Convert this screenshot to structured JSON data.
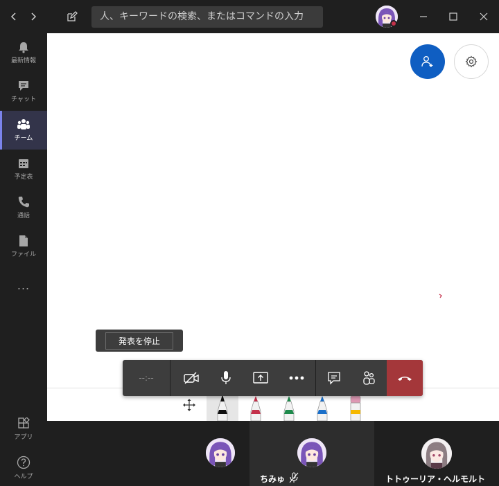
{
  "titlebar": {
    "search_placeholder": "人、キーワードの検索、またはコマンドの入力"
  },
  "rail": {
    "items": [
      {
        "label": "最新情報",
        "icon": "bell-icon"
      },
      {
        "label": "チャット",
        "icon": "chat-icon"
      },
      {
        "label": "チーム",
        "icon": "teams-icon"
      },
      {
        "label": "予定表",
        "icon": "calendar-icon"
      },
      {
        "label": "通話",
        "icon": "phone-icon"
      },
      {
        "label": "ファイル",
        "icon": "file-icon"
      }
    ],
    "more_label": "...",
    "apps_label": "アプリ",
    "help_label": "ヘルプ"
  },
  "meeting": {
    "stop_present_label": "発表を停止",
    "timer": "--:--"
  },
  "participants": [
    {
      "name": ""
    },
    {
      "name": "ちみゅ"
    },
    {
      "name": "トトゥーリア・ヘルモルト"
    }
  ],
  "colors": {
    "accent": "#0f5ec2",
    "hangup": "#a4373a",
    "rail_active": "#33344a"
  }
}
